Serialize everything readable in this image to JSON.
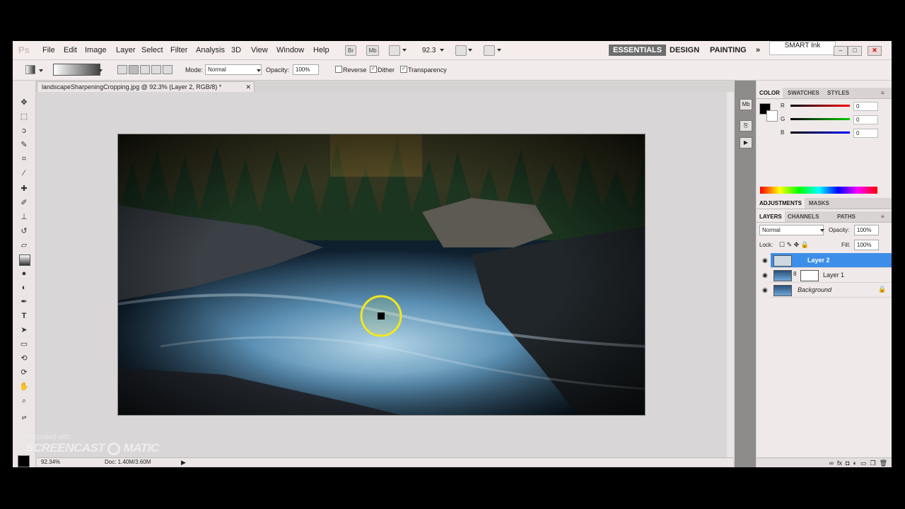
{
  "menubar": {
    "logo": "Ps",
    "items": [
      "File",
      "Edit",
      "Image",
      "Layer",
      "Select",
      "Filter",
      "Analysis",
      "3D",
      "View",
      "Window",
      "Help"
    ],
    "br_label": "Br",
    "mb_label": "Mb",
    "zoom": "92.3",
    "workspaces": [
      "ESSENTIALS",
      "DESIGN",
      "PAINTING"
    ],
    "more": "»",
    "smart_ink": "SMART Ink"
  },
  "options": {
    "mode_label": "Mode:",
    "mode_value": "Normal",
    "opacity_label": "Opacity:",
    "opacity_value": "100%",
    "reverse_label": "Reverse",
    "dither_label": "Dither",
    "transparency_label": "Transparency",
    "reverse": false,
    "dither": true,
    "transparency": true
  },
  "document": {
    "tab_title": "landscapeSharpeningCropping.jpg @ 92.3% (Layer 2, RGB/8) *",
    "status_zoom": "92.34%",
    "status_doc": "Doc: 1.40M/3.60M"
  },
  "watermark": {
    "line1": "Recorded with",
    "line2": "SCREENCAST",
    "line3": "MATIC"
  },
  "color_panel": {
    "tabs": [
      "COLOR",
      "SWATCHES",
      "STYLES"
    ],
    "r_label": "R",
    "g_label": "G",
    "b_label": "B",
    "r": "0",
    "g": "0",
    "b": "0",
    "fg": "#000000"
  },
  "adjust_panel": {
    "tabs": [
      "ADJUSTMENTS",
      "MASKS"
    ]
  },
  "layers_panel": {
    "tabs": [
      "LAYERS",
      "CHANNELS",
      "PATHS"
    ],
    "blend_mode": "Normal",
    "opacity_label": "Opacity:",
    "opacity_value": "100%",
    "lock_label": "Lock:",
    "fill_label": "Fill:",
    "fill_value": "100%",
    "layers": [
      {
        "name": "Layer 2",
        "selected": true
      },
      {
        "name": "Layer 1",
        "selected": false
      },
      {
        "name": "Background",
        "selected": false
      }
    ]
  },
  "colors": {
    "accent": "#3d8ee8",
    "cursor_ring": "#f0e81e"
  }
}
